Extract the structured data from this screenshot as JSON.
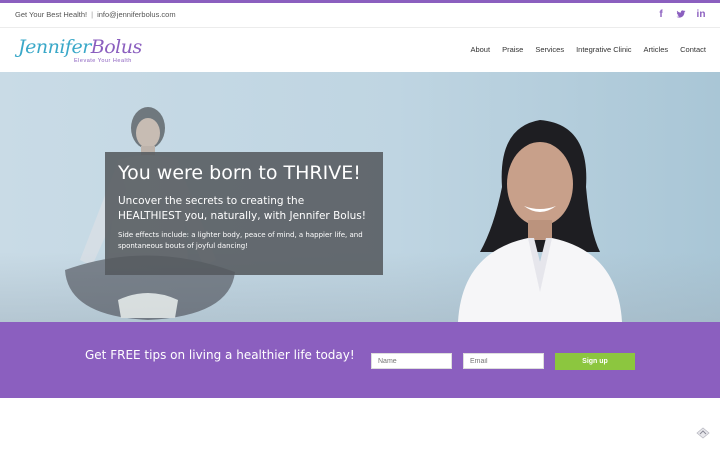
{
  "topbar": {
    "tagline": "Get Your Best Health!",
    "separator": "|",
    "email": "info@jenniferbolus.com",
    "social": [
      {
        "icon": "facebook-icon",
        "glyph": "f"
      },
      {
        "icon": "twitter-icon",
        "glyph": "t"
      },
      {
        "icon": "linkedin-icon",
        "glyph": "in"
      }
    ]
  },
  "logo": {
    "first": "Jennifer",
    "last": "Bolus",
    "tagline": "Elevate Your Health"
  },
  "nav": {
    "items": [
      "About",
      "Praise",
      "Services",
      "Integrative Clinic",
      "Articles",
      "Contact"
    ]
  },
  "hero": {
    "title": "You were born to THRIVE!",
    "subtitle": "Uncover the secrets to creating the HEALTHIEST you, naturally, with Jennifer Bolus!",
    "body": "Side effects include: a lighter body, peace of mind, a happier life, and spontaneous bouts of joyful dancing!"
  },
  "signup": {
    "heading": "Get FREE tips on living a healthier life today!",
    "name_placeholder": "Name",
    "email_placeholder": "Email",
    "button_label": "Sign up"
  },
  "colors": {
    "brand_purple": "#8b5fbf",
    "brand_teal": "#3aa8c8",
    "cta_green": "#8cc63f"
  }
}
